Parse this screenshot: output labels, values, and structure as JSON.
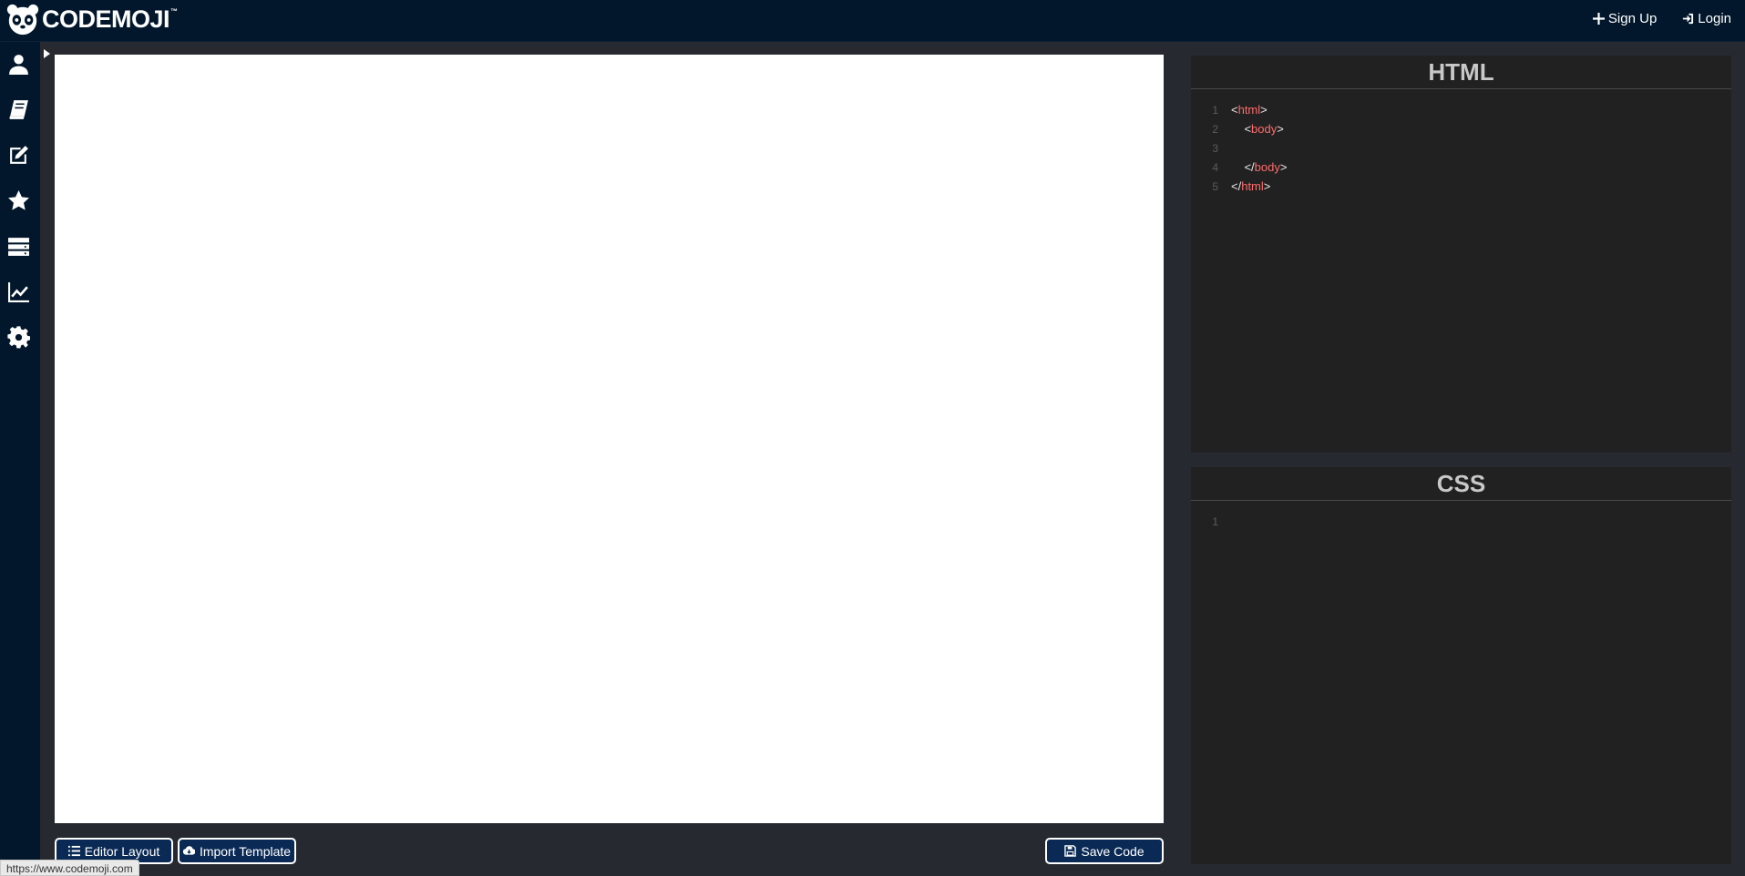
{
  "brand": {
    "name": "CODEMOJI",
    "tm": "™"
  },
  "topnav": {
    "signup_label": "Sign Up",
    "login_label": "Login"
  },
  "sidebar": {
    "items": [
      {
        "icon": "user-icon"
      },
      {
        "icon": "book-icon"
      },
      {
        "icon": "edit-icon"
      },
      {
        "icon": "star-icon"
      },
      {
        "icon": "server-icon"
      },
      {
        "icon": "chart-line-icon"
      },
      {
        "icon": "gear-icon"
      }
    ]
  },
  "html_editor": {
    "title": "HTML",
    "lines": [
      {
        "num": "1",
        "open": "<",
        "tag": "html",
        "close": ">",
        "indent": ""
      },
      {
        "num": "2",
        "open": "<",
        "tag": "body",
        "close": ">",
        "indent": "    "
      },
      {
        "num": "3",
        "open": "",
        "tag": "",
        "close": "",
        "indent": ""
      },
      {
        "num": "4",
        "open": "</",
        "tag": "body",
        "close": ">",
        "indent": "    "
      },
      {
        "num": "5",
        "open": "</",
        "tag": "html",
        "close": ">",
        "indent": ""
      }
    ]
  },
  "css_editor": {
    "title": "CSS",
    "lines": [
      {
        "num": "1"
      }
    ]
  },
  "buttons": {
    "editor_layout": "Editor Layout",
    "import_template": "Import Template",
    "save_code": "Save Code"
  },
  "status_url": "https://www.codemoji.com",
  "colors": {
    "navbar": "#02172b",
    "background": "#262a30",
    "editor_bg": "#212121",
    "tag_color": "#ff6b6b",
    "button_bg": "#0a2a55"
  }
}
